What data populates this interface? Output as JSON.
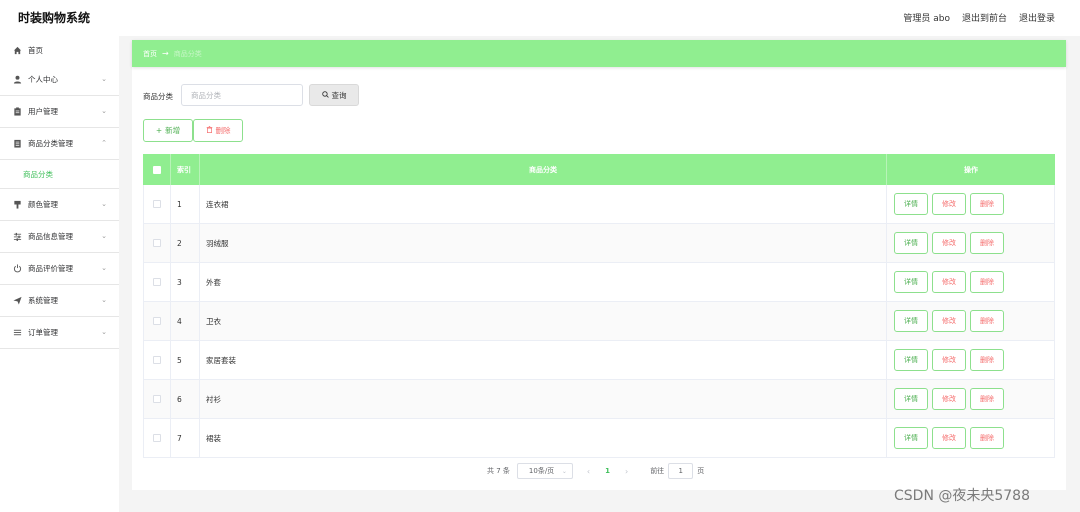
{
  "header": {
    "title": "时装购物系统",
    "admin_label": "管理员 abo",
    "to_front_label": "退出到前台",
    "logout_label": "退出登录"
  },
  "sidebar": {
    "items": [
      {
        "label": "首页",
        "icon": "home-icon"
      },
      {
        "label": "个人中心",
        "icon": "user-icon"
      },
      {
        "label": "用户管理",
        "icon": "clipboard-icon"
      },
      {
        "label": "商品分类管理",
        "icon": "document-icon"
      },
      {
        "label": "商品分类",
        "icon": ""
      },
      {
        "label": "颜色管理",
        "icon": "brush-icon"
      },
      {
        "label": "商品信息管理",
        "icon": "sliders-icon"
      },
      {
        "label": "商品评价管理",
        "icon": "power-icon"
      },
      {
        "label": "系统管理",
        "icon": "send-icon"
      },
      {
        "label": "订单管理",
        "icon": "menu-icon"
      }
    ]
  },
  "breadcrumb": {
    "home": "首页",
    "current": "商品分类"
  },
  "search": {
    "label": "商品分类",
    "placeholder": "商品分类",
    "button": "查询"
  },
  "toolbar": {
    "add_label": "新增",
    "delete_label": "删除"
  },
  "table": {
    "headers": {
      "index": "索引",
      "name": "商品分类",
      "actions": "操作"
    },
    "rows": [
      {
        "index": "1",
        "name": "连衣裙"
      },
      {
        "index": "2",
        "name": "羽绒服"
      },
      {
        "index": "3",
        "name": "外套"
      },
      {
        "index": "4",
        "name": "卫衣"
      },
      {
        "index": "5",
        "name": "家居套装"
      },
      {
        "index": "6",
        "name": "衬衫"
      },
      {
        "index": "7",
        "name": "裙装"
      }
    ],
    "row_actions": {
      "detail": "详情",
      "edit": "修改",
      "remove": "删除"
    }
  },
  "pagination": {
    "total": "共 7 条",
    "page_size": "10条/页",
    "current_page": "1",
    "goto_prefix": "前往",
    "goto_value": "1",
    "goto_suffix": "页"
  },
  "watermark": "CSDN @夜未央5788",
  "colors": {
    "accent": "#90ee90",
    "active_text": "#3fbf5a",
    "danger": "#f56c6c"
  }
}
